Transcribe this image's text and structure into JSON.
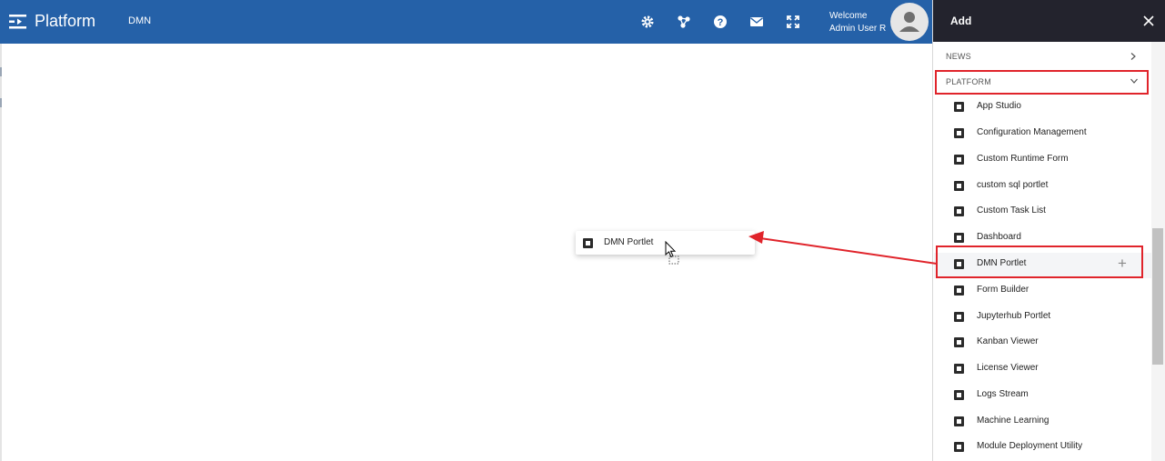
{
  "header": {
    "brand": "Platform",
    "breadcrumb": "DMN",
    "welcome_line1": "Welcome",
    "welcome_line2": "Admin User R"
  },
  "drag_ghost": {
    "label": "DMN Portlet"
  },
  "panel": {
    "title": "Add",
    "sections": [
      {
        "label": "NEWS",
        "state": "collapsed"
      },
      {
        "label": "PLATFORM",
        "state": "expanded"
      }
    ],
    "items": [
      {
        "label": "App Studio"
      },
      {
        "label": "Configuration Management"
      },
      {
        "label": "Custom Runtime Form"
      },
      {
        "label": "custom sql portlet"
      },
      {
        "label": "Custom Task List"
      },
      {
        "label": "Dashboard"
      },
      {
        "label": "DMN Portlet",
        "hovered": true
      },
      {
        "label": "Form Builder"
      },
      {
        "label": "Jupyterhub Portlet"
      },
      {
        "label": "Kanban Viewer"
      },
      {
        "label": "License Viewer"
      },
      {
        "label": "Logs Stream"
      },
      {
        "label": "Machine Learning"
      },
      {
        "label": "Module Deployment Utility"
      }
    ]
  },
  "icons": {
    "header": [
      "hamburger-icon",
      "settings-icon",
      "network-icon",
      "help-icon",
      "mail-icon",
      "fullscreen-icon",
      "user-avatar-icon"
    ],
    "panel": [
      "close-icon",
      "chevron-right-icon",
      "chevron-down-icon",
      "portlet-icon",
      "plus-icon"
    ]
  },
  "colors": {
    "header_bg": "#2561a8",
    "panel_header_bg": "#23232d",
    "annotation_red": "#e0242b"
  }
}
